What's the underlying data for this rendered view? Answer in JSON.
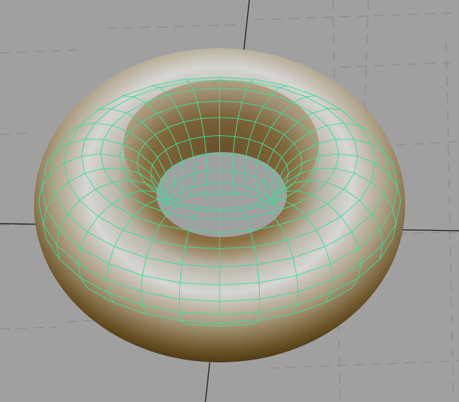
{
  "viewport": {
    "background_color": "#a0a0a0",
    "grid_color": "#8a8a8a",
    "axis_color": "#222222",
    "grid_style": "dashed"
  },
  "torus": {
    "name": "torus-object",
    "selected": true,
    "shading": "smooth-shaded-with-wireframe-on-shaded",
    "wireframe_color": "#3fdc9a",
    "shade_light": "#d0d0cf",
    "shade_mid": "#8c7a58",
    "shade_dark": "#3a2c10",
    "sections_around": 28,
    "sections_tube": 20
  }
}
